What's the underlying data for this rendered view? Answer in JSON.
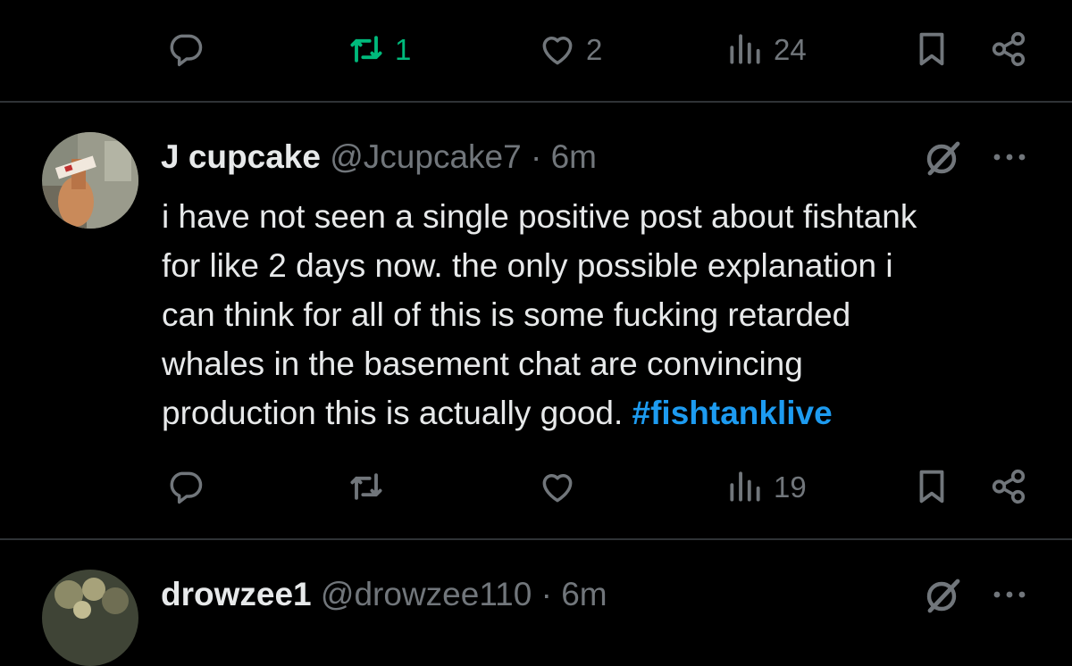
{
  "colors": {
    "background": "#000000",
    "text": "#e7e9ea",
    "muted": "#71767b",
    "divider": "#2f3336",
    "retweet_active": "#00ba7c",
    "hashtag": "#1d9bf0"
  },
  "top_post_actions": {
    "reply": {
      "icon": "reply-icon",
      "count": ""
    },
    "repost": {
      "icon": "repost-icon",
      "count": "1",
      "active": true
    },
    "like": {
      "icon": "heart-icon",
      "count": "2"
    },
    "views": {
      "icon": "views-icon",
      "count": "24"
    },
    "bookmark": {
      "icon": "bookmark-icon"
    },
    "share": {
      "icon": "share-icon"
    }
  },
  "post": {
    "display_name": "J cupcake",
    "handle": "@Jcupcake7",
    "separator": "·",
    "time": "6m",
    "text": "i have not seen a single positive post about fishtank\nfor like 2 days now. the only possible explanation i\ncan think for all of this is some fucking retarded\nwhales in the basement chat are convincing\nproduction this is actually good. ",
    "hashtag": "#fishtanklive",
    "grok_icon": "grok-icon",
    "more_icon": "more-icon",
    "actions": {
      "reply": {
        "icon": "reply-icon",
        "count": ""
      },
      "repost": {
        "icon": "repost-icon",
        "count": ""
      },
      "like": {
        "icon": "heart-icon",
        "count": ""
      },
      "views": {
        "icon": "views-icon",
        "count": "19"
      },
      "bookmark": {
        "icon": "bookmark-icon"
      },
      "share": {
        "icon": "share-icon"
      }
    }
  },
  "next_post": {
    "display_name": "drowzee1",
    "handle": "@drowzee110",
    "separator": "·",
    "time": "6m"
  }
}
